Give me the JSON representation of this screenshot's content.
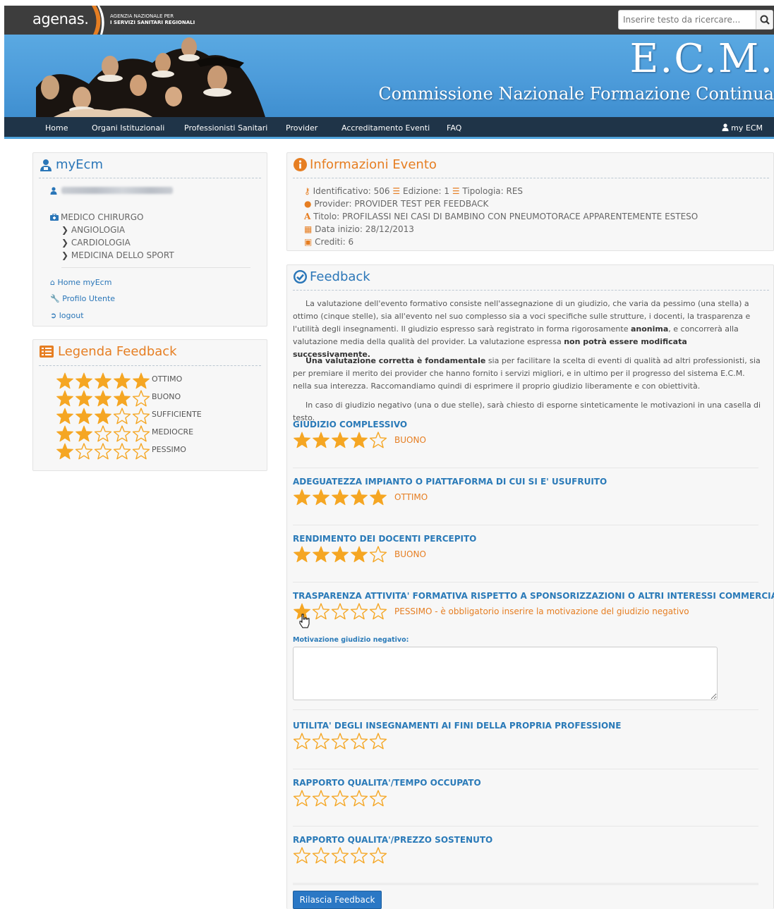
{
  "header": {
    "logo_text": "agenas.",
    "logo_caption_line1": "AGENZIA NAZIONALE PER",
    "logo_caption_line2": "I SERVIZI SANITARI REGIONALI",
    "search_placeholder": "Inserire testo da ricercare..."
  },
  "banner": {
    "title": "E.C.M.",
    "subtitle": "Commissione Nazionale Formazione Continua"
  },
  "nav": {
    "items": [
      "Home",
      "Organi Istituzionali",
      "Professionisti Sanitari",
      "Provider",
      "Accreditamento Eventi",
      "FAQ"
    ],
    "user_label": "my ECM"
  },
  "sidebar": {
    "myecm_title": "myEcm",
    "profession": "MEDICO CHIRURGO",
    "specialties": [
      "ANGIOLOGIA",
      "CARDIOLOGIA",
      "MEDICINA DELLO SPORT"
    ],
    "links": [
      "Home myEcm",
      "Profilo Utente",
      "logout"
    ],
    "legend_title": "Legenda Feedback",
    "legend": [
      {
        "label": "OTTIMO",
        "stars": 5
      },
      {
        "label": "BUONO",
        "stars": 4
      },
      {
        "label": "SUFFICIENTE",
        "stars": 3
      },
      {
        "label": "MEDIOCRE",
        "stars": 2
      },
      {
        "label": "PESSIMO",
        "stars": 1
      }
    ]
  },
  "event": {
    "title": "Informazioni Evento",
    "identificativo": "Identificativo: 506",
    "edizione": "Edizione: 1",
    "tipologia": "Tipologia: RES",
    "provider": "Provider: PROVIDER TEST PER FEEDBACK",
    "titolo": "Titolo: PROFILASSI NEI CASI DI BAMBINO CON PNEUMOTORACE APPARENTEMENTE ESTESO",
    "data_inizio": "Data inizio: 28/12/2013",
    "crediti": "Crediti: 6"
  },
  "feedback": {
    "title": "Feedback",
    "para1_a": "La valutazione dell'evento formativo consiste nell'assegnazione di un giudizio, che varia da pessimo (una stella) a ottimo (cinque stelle), sia all'evento nel suo complesso sia a voci specifiche sulle strutture, i docenti, la trasparenza e l'utilità degli insegnamenti. Il giudizio espresso sarà registrato in forma rigorosamente ",
    "para1_b": "anonima",
    "para1_c": ", e concorrerà alla valutazione media della qualità del provider. La valutazione espressa ",
    "para1_d": "non potrà essere modificata successivamente.",
    "para2_a": "Una valutazione corretta è fondamentale",
    "para2_b": " sia per facilitare la scelta di eventi di qualità ad altri professionisti, sia per premiare il merito dei provider che hanno fornito i servizi migliori, e in ultimo per il progresso del sistema E.C.M. nella sua interezza. Raccomandiamo quindi di esprimere il proprio giudizio liberamente e con obiettività.",
    "para3": "In caso di giudizio negativo (una o due stelle), sarà chiesto di esporne sinteticamente le motivazioni in una casella di testo.",
    "questions": [
      {
        "label": "GIUDIZIO COMPLESSIVO",
        "rating": 4,
        "value": "BUONO"
      },
      {
        "label": "ADEGUATEZZA IMPIANTO O PIATTAFORMA DI CUI SI E' USUFRUITO",
        "rating": 5,
        "value": "OTTIMO"
      },
      {
        "label": "RENDIMENTO DEI DOCENTI PERCEPITO",
        "rating": 4,
        "value": "BUONO"
      },
      {
        "label": "TRASPARENZA ATTIVITA' FORMATIVA RISPETTO A SPONSORIZZAZIONI O ALTRI INTERESSI COMMERCIALI",
        "rating": 1,
        "value": "PESSIMO - è obbligatorio inserire la motivazione del giudizio negativo"
      },
      {
        "label": "UTILITA' DEGLI INSEGNAMENTI AI FINI DELLA PROPRIA PROFESSIONE",
        "rating": 0,
        "value": ""
      },
      {
        "label": "RAPPORTO QUALITA'/TEMPO OCCUPATO",
        "rating": 0,
        "value": ""
      },
      {
        "label": "RAPPORTO QUALITA'/PREZZO SOSTENUTO",
        "rating": 0,
        "value": ""
      }
    ],
    "motivazione_label": "Motivazione giudizio negativo:",
    "submit_label": "Rilascia Feedback"
  },
  "colors": {
    "accent_orange": "#e67e22",
    "star_gold": "#f5a623",
    "link_blue": "#2a7ab8",
    "nav_dark": "#1f3448"
  }
}
